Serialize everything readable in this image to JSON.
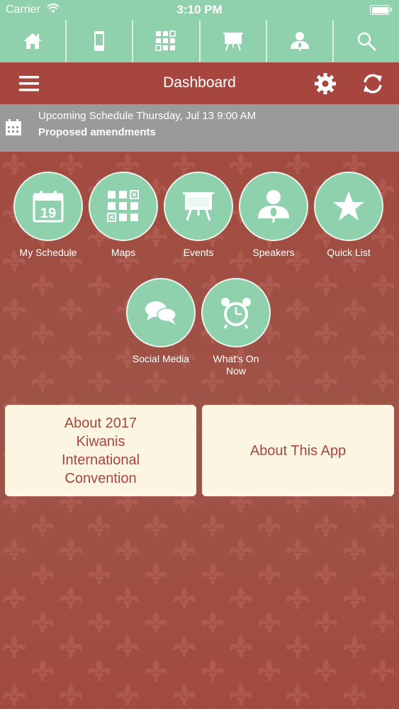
{
  "status_bar": {
    "carrier": "Carrier",
    "time": "3:10 PM"
  },
  "nav": [
    {
      "name": "home",
      "icon": "home-icon"
    },
    {
      "name": "mobile",
      "icon": "phone-icon"
    },
    {
      "name": "maps",
      "icon": "grid-map-icon"
    },
    {
      "name": "events",
      "icon": "easel-icon"
    },
    {
      "name": "speakers",
      "icon": "speaker-icon"
    },
    {
      "name": "search",
      "icon": "search-icon"
    }
  ],
  "header": {
    "title": "Dashboard"
  },
  "banner": {
    "line1": "Upcoming Schedule Thursday, Jul 13 9:00 AM",
    "line2": "Proposed amendments"
  },
  "tiles": [
    {
      "label": "My Schedule",
      "icon": "calendar-icon",
      "day": "19"
    },
    {
      "label": "Maps",
      "icon": "grid-map-icon"
    },
    {
      "label": "Events",
      "icon": "easel-icon"
    },
    {
      "label": "Speakers",
      "icon": "speaker-icon"
    },
    {
      "label": "Quick List",
      "icon": "star-icon"
    },
    {
      "label": "Social Media",
      "icon": "chat-bubbles-icon"
    },
    {
      "label": "What's On Now",
      "icon": "alarm-clock-icon"
    }
  ],
  "cards": [
    {
      "label": "About 2017 Kiwanis International Convention"
    },
    {
      "label": "About This App"
    }
  ],
  "colors": {
    "mint": "#8fd1ad",
    "header_red": "#a6463f",
    "background": "#9e4f44",
    "banner_gray": "#9a9a9a",
    "card_cream": "#fbf5e2"
  }
}
